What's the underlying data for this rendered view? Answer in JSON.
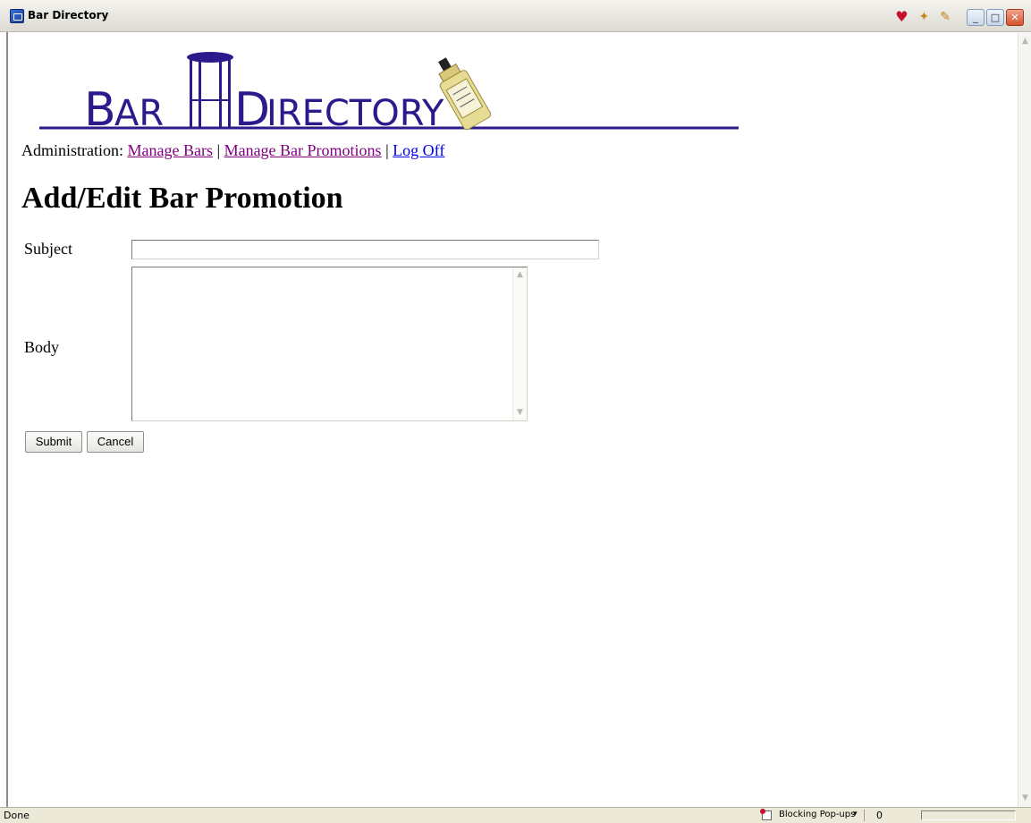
{
  "window": {
    "title": "Bar Directory",
    "buttons": {
      "minimize": "_",
      "maximize": "□",
      "close": "✕"
    },
    "toolbar_icons": [
      "heart-icon",
      "sparkle-icon",
      "edit-page-icon"
    ]
  },
  "logo": {
    "text_bar_initial": "B",
    "text_bar_rest": "AR",
    "text_dir_initial": "D",
    "text_dir_rest": "IRECTORY",
    "color": "#2a1a8c",
    "accent": "#3b1f9e"
  },
  "nav": {
    "prefix": "Administration:",
    "manage_bars": "Manage Bars",
    "sep1": "|",
    "manage_promotions": "Manage Bar Promotions",
    "sep2": "|",
    "log_off": "Log Off"
  },
  "page": {
    "title": "Add/Edit Bar Promotion"
  },
  "form": {
    "subject_label": "Subject",
    "subject_value": "",
    "body_label": "Body",
    "body_value": "",
    "submit_label": "Submit",
    "cancel_label": "Cancel"
  },
  "status": {
    "text": "Done",
    "popup_text": "Blocking Pop-ups",
    "dropdown": "▾",
    "count": "0"
  }
}
